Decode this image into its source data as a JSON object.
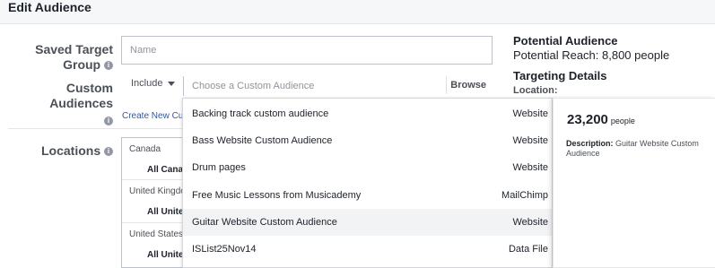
{
  "header": {
    "title": "Edit Audience"
  },
  "form": {
    "saved_target_group_label_line1": "Saved Target",
    "saved_target_group_label_line2": "Group",
    "name_placeholder": "Name",
    "custom_audiences_label": "Custom Audiences",
    "include_label": "Include",
    "audience_placeholder": "Choose a Custom Audience",
    "browse_label": "Browse",
    "create_new_label": "Create New Cu",
    "locations_label": "Locations",
    "info_glyph": "i"
  },
  "locations": [
    {
      "country": "Canada",
      "sub": "All Cana"
    },
    {
      "country": "United Kingdo",
      "sub": "All Unite"
    },
    {
      "country": "United States",
      "sub": "All Unite"
    }
  ],
  "right_panel": {
    "potential_audience_title": "Potential Audience",
    "potential_reach": "Potential Reach: 8,800 people",
    "targeting_details_title": "Targeting Details",
    "location_label": "Location:"
  },
  "dropdown": {
    "items": [
      {
        "name": "Backing track custom audience",
        "type": "Website"
      },
      {
        "name": "Bass Website Custom Audience",
        "type": "Website"
      },
      {
        "name": "Drum pages",
        "type": "Website"
      },
      {
        "name": "Free Music Lessons from Musicademy",
        "type": "MailChimp"
      },
      {
        "name": "Guitar Website Custom Audience",
        "type": "Website"
      },
      {
        "name": "ISList25Nov14",
        "type": "Data File"
      }
    ],
    "highlighted_index": 4
  },
  "hover_card": {
    "count": "23,200",
    "unit": "people",
    "description_label": "Description:",
    "description_text": "Guitar Website Custom Audience"
  },
  "colors": {
    "link": "#365899",
    "highlight_row": "#f2f3f5"
  }
}
